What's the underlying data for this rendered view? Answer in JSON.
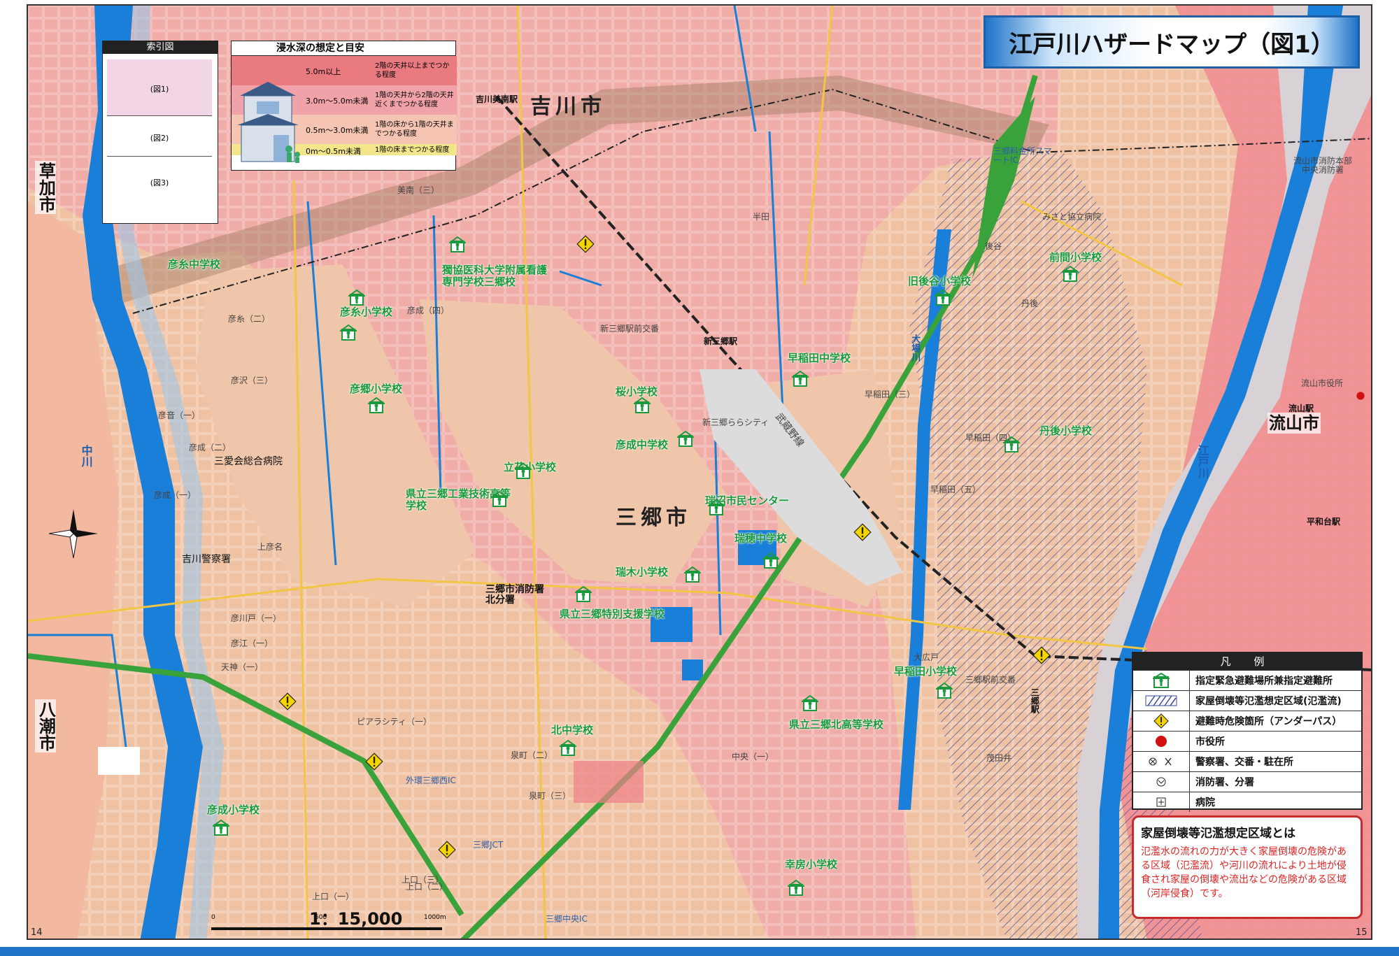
{
  "title": "江戸川ハザードマップ（図1）",
  "index_map": {
    "heading": "索引図",
    "cells": [
      "(図1)",
      "(図2)",
      "(図3)"
    ]
  },
  "depth_legend": {
    "title": "浸水深の想定と目安",
    "rows": [
      {
        "range": "5.0m以上",
        "desc": "2階の天井以上までつかる程度",
        "color": "#e87a80"
      },
      {
        "range": "3.0m～5.0m未満",
        "desc": "1階の天井から2階の天井近くまでつかる程度",
        "color": "#f0a2a8"
      },
      {
        "range": "0.5m～3.0m未満",
        "desc": "1階の床から1階の天井までつかる程度",
        "color": "#f6c4b2"
      },
      {
        "range": "0m～0.5m未満",
        "desc": "1階の床までつかる程度",
        "color": "#f3e68a"
      }
    ]
  },
  "legend": {
    "heading": "凡 例",
    "items": [
      {
        "icon": "shelter-icon",
        "text": "指定緊急避難場所兼指定避難所"
      },
      {
        "icon": "hatch-icon",
        "text": "家屋倒壊等氾濫想定区域(氾濫流)"
      },
      {
        "icon": "warning-icon",
        "text": "避難時危険箇所（アンダーパス）"
      },
      {
        "icon": "city-hall-icon",
        "text": "市役所"
      },
      {
        "icon": "police-icon",
        "text": "警察署、交番・駐在所"
      },
      {
        "icon": "fire-station-icon",
        "text": "消防署、分署"
      },
      {
        "icon": "hospital-icon",
        "text": "病院"
      }
    ]
  },
  "info": {
    "title": "家屋倒壊等氾濫想定区域とは",
    "text": "氾濫水の流れの力が大きく家屋倒壊の危険がある区域（氾濫流）や河川の流れにより土地が侵食され家屋の倒壊や流出などの危険がある区域（河岸侵食）です。"
  },
  "scale": {
    "ratio": "1：15,000",
    "ticks": [
      "0",
      "500",
      "1000m"
    ]
  },
  "page_numbers": {
    "left": "14",
    "right": "15"
  },
  "places": {
    "yoshikawa": "吉川市",
    "misato": "三郷市",
    "nagareyama": "流山市",
    "soka": "草加市",
    "yashio": "八潮市"
  },
  "rivers": {
    "naka": "中川",
    "edo": "江戸川",
    "oba": "大場川"
  },
  "stations": {
    "yoshikawa_minami": "吉川美南駅",
    "shin_misato": "新三郷駅",
    "misato": "三郷駅",
    "nagareyama": "流山駅",
    "heiwadai": "平和台駅"
  },
  "facilities": {
    "hospital": "三愛会総合病院",
    "police": "吉川警察署",
    "fire": "三郷市消防署 北分署",
    "nagareyama_hall": "流山市役所",
    "nagareyama_fire": "流山市消防本部 中央消防署",
    "misato_hospital": "みさと協立病院",
    "koban_shinmisato": "新三郷駅前交番",
    "koban_misato": "三郷駅前交番",
    "ic_misato_nishi": "外環三郷西IC",
    "jct": "三郷JCT",
    "ic_chuo": "三郷中央IC",
    "skip_ic": "三郷料金所スマートIC",
    "musashino_line": "武蔵野線"
  },
  "schools": [
    "彦糸中学校",
    "獨協医科大学附属看護専門学校三郷校",
    "彦糸小学校",
    "彦郷小学校",
    "桜小学校",
    "彦成中学校",
    "立花小学校",
    "県立三郷工業技術高等学校",
    "瑞沼市民センター",
    "瑞穂中学校",
    "瑞木小学校",
    "県立三郷特別支援学校",
    "早稲田中学校",
    "旧後谷小学校",
    "前間小学校",
    "丹後小学校",
    "早稲田小学校",
    "県立三郷北高等学校",
    "北中学校",
    "彦成小学校",
    "幸房小学校"
  ],
  "town_names": [
    "美南（三）",
    "彦糸（二）",
    "彦成（四）",
    "彦沢（三）",
    "彦音（一）",
    "彦成（二）",
    "彦成（一）",
    "上彦名",
    "彦川戸（一）",
    "彦江（一）",
    "天神（一）",
    "ピアラシティ（一）",
    "泉町（二）",
    "泉町（三）",
    "上口（三）",
    "上口（二）",
    "上口（一）",
    "新三郷ららシティ",
    "中央（一）",
    "早稲田（五）",
    "早稲田（四）",
    "早稲田（三）",
    "茂田井",
    "大広戸",
    "半田",
    "後谷",
    "丹後"
  ]
}
